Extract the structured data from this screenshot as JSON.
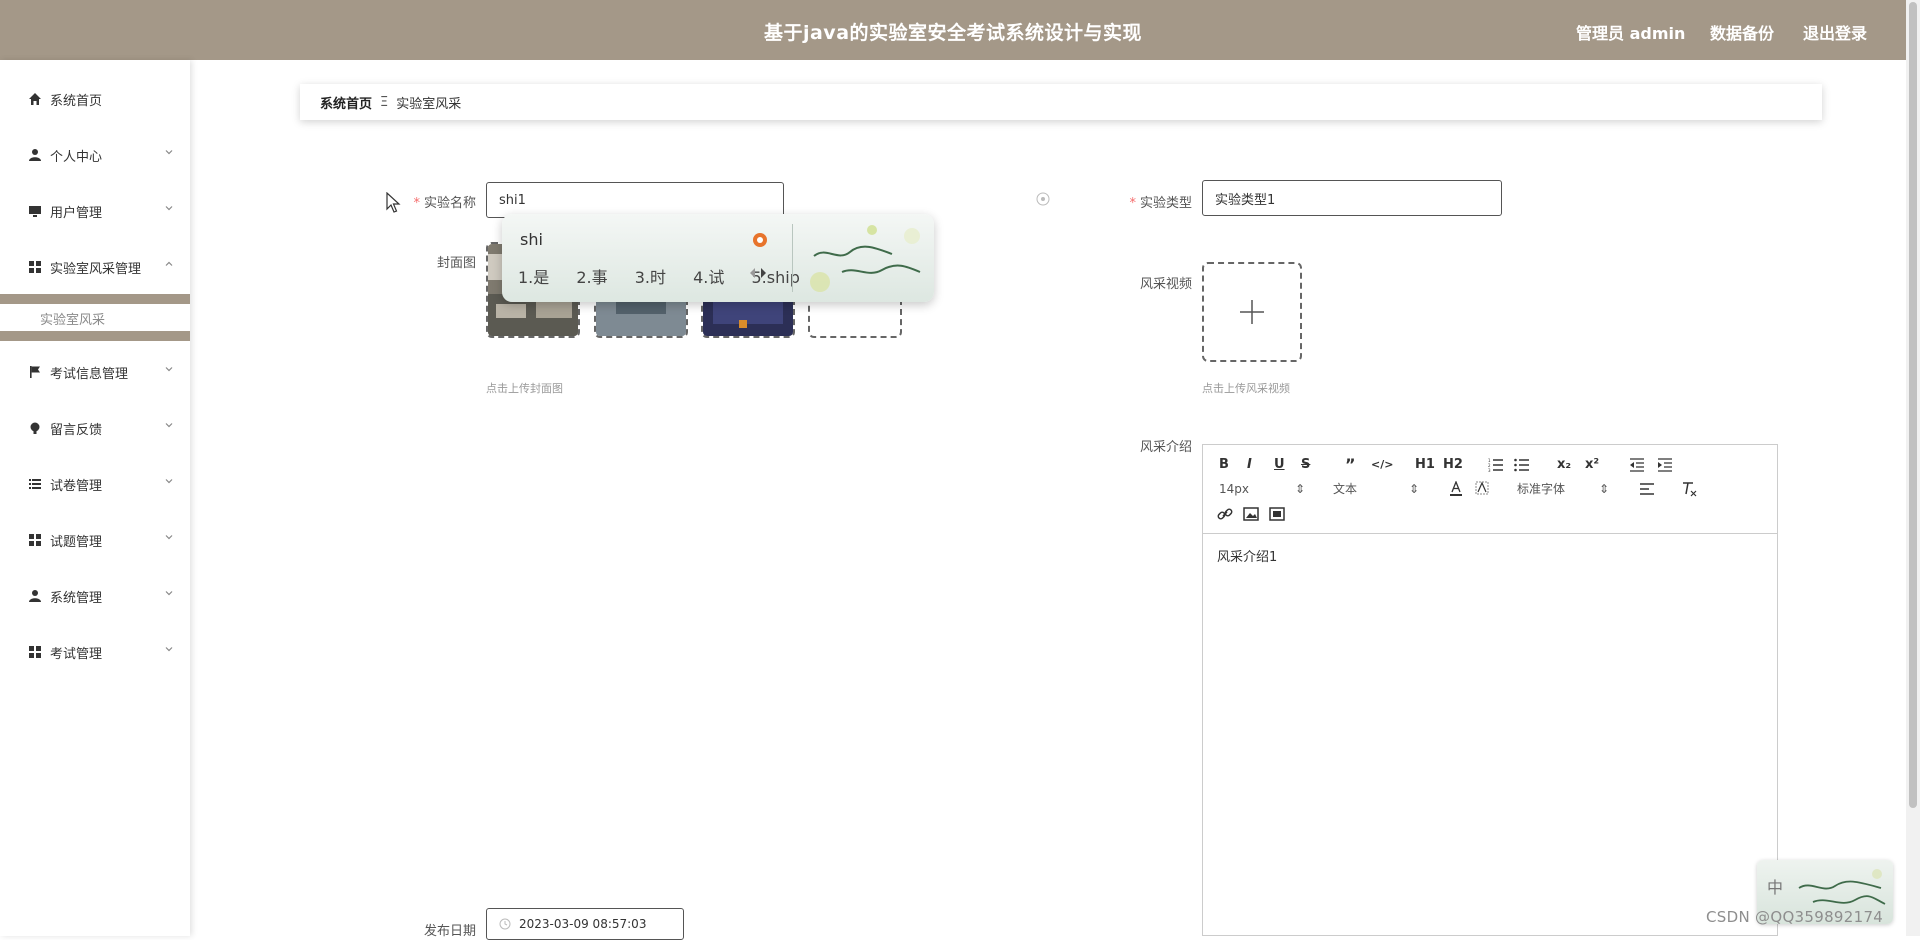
{
  "header": {
    "title": "基于java的实验室安全考试系统设计与实现",
    "admin_label": "管理员 admin",
    "backup_label": "数据备份",
    "logout_label": "退出登录"
  },
  "sidebar": {
    "items": [
      {
        "label": "系统首页",
        "icon": "home-icon"
      },
      {
        "label": "个人中心",
        "icon": "user-icon"
      },
      {
        "label": "用户管理",
        "icon": "monitor-icon"
      },
      {
        "label": "实验室风采管理",
        "icon": "grid-icon"
      },
      {
        "label": "考试信息管理",
        "icon": "flag-icon"
      },
      {
        "label": "留言反馈",
        "icon": "bulb-icon"
      },
      {
        "label": "试卷管理",
        "icon": "list-icon"
      },
      {
        "label": "试题管理",
        "icon": "grid-icon"
      },
      {
        "label": "系统管理",
        "icon": "user-icon"
      },
      {
        "label": "考试管理",
        "icon": "grid-icon"
      }
    ],
    "submenu": {
      "label": "实验室风采"
    }
  },
  "breadcrumb": {
    "home": "系统首页",
    "separator": "Ξ",
    "current": "实验室风采"
  },
  "form": {
    "name_label": "实验名称",
    "name_value": "shi1",
    "type_label": "实验类型",
    "type_value": "实验类型1",
    "cover_label": "封面图",
    "cover_hint": "点击上传封面图",
    "video_label": "风采视频",
    "video_hint": "点击上传风采视频",
    "intro_label": "风采介绍",
    "intro_content": "风采介绍1",
    "date_label": "发布日期",
    "date_value": "2023-03-09 08:57:03",
    "required_mark": "*"
  },
  "editor": {
    "font_size": "14px",
    "paragraph": "文本",
    "font_family": "标准字体",
    "buttons": [
      "B",
      "I",
      "U",
      "S",
      "”",
      "</>",
      "H1",
      "H2",
      "ordered-list",
      "bullet-list",
      "x₂",
      "x²",
      "outdent",
      "indent",
      "text-color",
      "background",
      "align",
      "clear-format",
      "link",
      "image",
      "video"
    ]
  },
  "ime": {
    "composition": "shi",
    "candidates": [
      "1.是",
      "2.事",
      "3.时",
      "4.试",
      "5.ship"
    ],
    "mini_label": "中"
  },
  "watermark": "CSDN @QQ359892174",
  "colors": {
    "header_bg": "#a49888",
    "required": "#f56c6c",
    "sidebar_active_band": "#a49888"
  }
}
